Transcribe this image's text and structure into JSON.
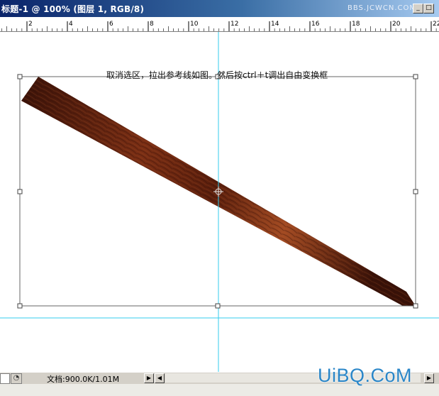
{
  "window": {
    "title": "标题-1 @ 100% (图层 1, RGB/8)",
    "watermark_top": "BBS.JCWCN.COM",
    "minimize_label": "_",
    "maximize_label": "□"
  },
  "ruler": {
    "labels": [
      "2",
      "4",
      "6",
      "8",
      "10",
      "12",
      "14",
      "16",
      "18",
      "20",
      "22"
    ]
  },
  "canvas": {
    "instruction": "取消选区，拉出参考线如图。然后按ctrl＋t调出自由变换框",
    "guide_color": "#33ccee",
    "texture_colors": [
      "#3a1208",
      "#7a2e14",
      "#a24a22",
      "#5a1e0c"
    ]
  },
  "statusbar": {
    "doc_info": "文档:900.0K/1.01M",
    "status_icon": "◔",
    "arrow_right": "▶",
    "arrow_left": "◀",
    "arrow_end": "▶"
  },
  "watermark_bottom": "UiBQ.CoM",
  "icons": {
    "transform_center": "crosshair-icon",
    "status": "clock-icon"
  }
}
